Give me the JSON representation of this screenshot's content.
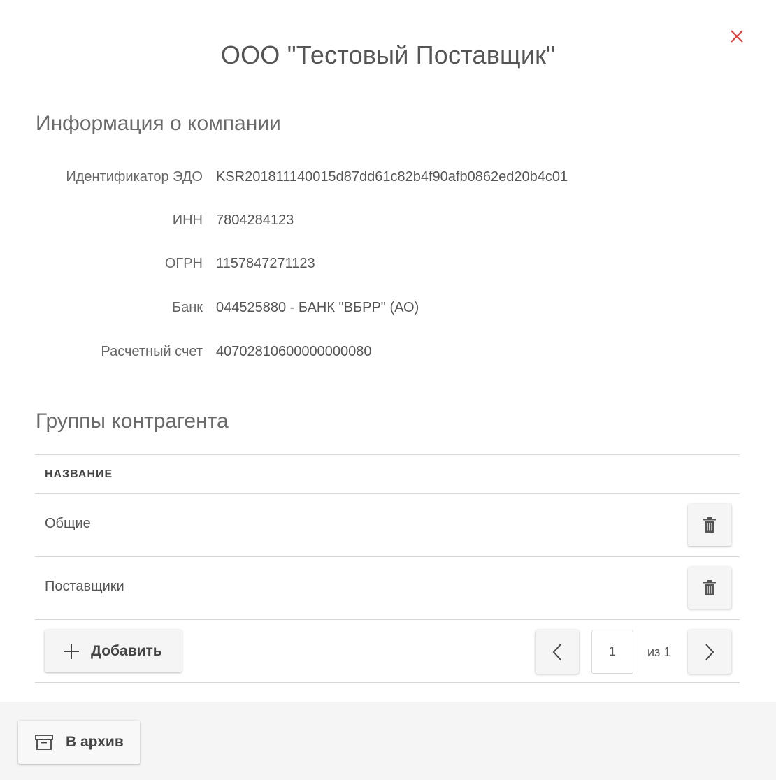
{
  "dialog": {
    "title": "ООО \"Тестовый Поставщик\""
  },
  "company_info": {
    "section_title": "Информация о компании",
    "fields": [
      {
        "label": "Идентификатор ЭДО",
        "value": "KSR201811140015d87dd61c82b4f90afb0862ed20b4c01"
      },
      {
        "label": "ИНН",
        "value": "7804284123"
      },
      {
        "label": "ОГРН",
        "value": "1157847271123"
      },
      {
        "label": "Банк",
        "value": "044525880 - БАНК \"ВБРР\" (АО)"
      },
      {
        "label": "Расчетный счет",
        "value": "40702810600000000080"
      }
    ]
  },
  "groups": {
    "section_title": "Группы контрагента",
    "column_header": "НАЗВАНИЕ",
    "rows": [
      {
        "name": "Общие"
      },
      {
        "name": "Поставщики"
      }
    ],
    "add_label": "Добавить",
    "pagination": {
      "current_page": "1",
      "of_label": "из 1"
    }
  },
  "footer": {
    "archive_label": "В архив"
  },
  "icons": {
    "close": "close-icon",
    "trash": "trash-icon",
    "plus": "plus-icon",
    "prev": "chevron-left-icon",
    "next": "chevron-right-icon",
    "archive": "archive-box-icon"
  },
  "colors": {
    "close_icon": "#e53935",
    "footer_bg": "#f5f5f5"
  }
}
